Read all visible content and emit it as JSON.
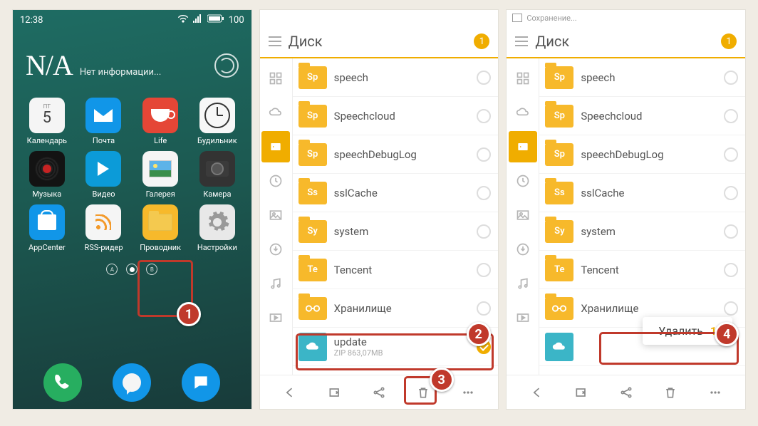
{
  "panel1": {
    "status": {
      "time": "12:38",
      "battery": "100"
    },
    "weather": {
      "na": "N/A",
      "info": "Нет информации..."
    },
    "apps": {
      "calendar": {
        "label": "Календарь",
        "dow": "ПТ",
        "day": "5"
      },
      "mail": {
        "label": "Почта"
      },
      "life": {
        "label": "Life"
      },
      "alarm": {
        "label": "Будильник"
      },
      "music": {
        "label": "Музыка"
      },
      "video": {
        "label": "Видео"
      },
      "gallery": {
        "label": "Галерея"
      },
      "camera": {
        "label": "Камера"
      },
      "appcenter": {
        "label": "AppCenter"
      },
      "rss": {
        "label": "RSS-ридер"
      },
      "files": {
        "label": "Проводник"
      },
      "settings": {
        "label": "Настройки"
      }
    },
    "badge": "1"
  },
  "panel2": {
    "title": "Диск",
    "selected_count": "1",
    "items": [
      {
        "abbr": "Sp",
        "name": "speech"
      },
      {
        "abbr": "Sp",
        "name": "Speechcloud"
      },
      {
        "abbr": "Sp",
        "name": "speechDebugLog"
      },
      {
        "abbr": "Ss",
        "name": "sslCache"
      },
      {
        "abbr": "Sy",
        "name": "system"
      },
      {
        "abbr": "Te",
        "name": "Tencent"
      },
      {
        "abbr": "",
        "name": "Хранилище",
        "glasses": true
      }
    ],
    "zip": {
      "name": "update",
      "sub": "ZIP 863,07MB"
    },
    "badges": {
      "b2": "2",
      "b3": "3"
    }
  },
  "panel3": {
    "saving_label": "Сохранение...",
    "title": "Диск",
    "selected_count": "1",
    "items": [
      {
        "abbr": "Sp",
        "name": "speech"
      },
      {
        "abbr": "Sp",
        "name": "Speechcloud"
      },
      {
        "abbr": "Sp",
        "name": "speechDebugLog"
      },
      {
        "abbr": "Ss",
        "name": "sslCache"
      },
      {
        "abbr": "Sy",
        "name": "system"
      },
      {
        "abbr": "Te",
        "name": "Tencent"
      },
      {
        "abbr": "",
        "name": "Хранилище",
        "glasses": true
      }
    ],
    "delete": {
      "label": "Удалить",
      "count": "1"
    },
    "badge": "4"
  }
}
